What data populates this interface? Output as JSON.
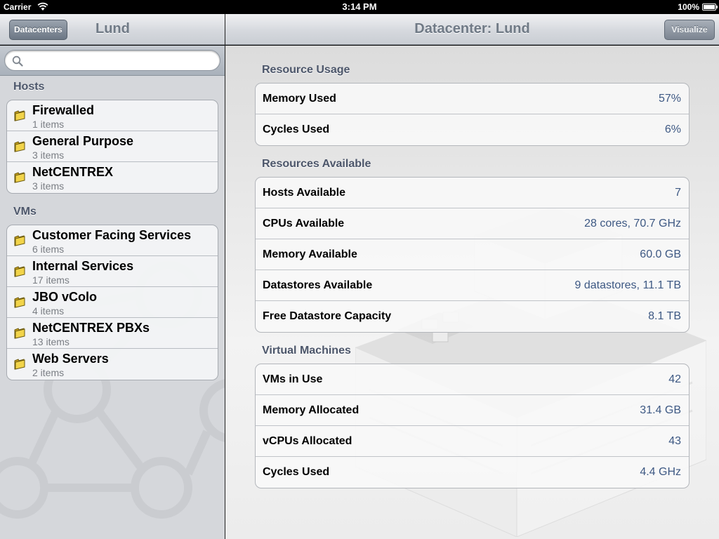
{
  "status": {
    "carrier": "Carrier",
    "time": "3:14 PM",
    "battery": "100%"
  },
  "master": {
    "back_label": "Datacenters",
    "title": "Lund",
    "search": {
      "placeholder": ""
    },
    "hosts_header": "Hosts",
    "hosts": [
      {
        "title": "Firewalled",
        "subtitle": "1 items"
      },
      {
        "title": "General Purpose",
        "subtitle": "3 items"
      },
      {
        "title": "NetCENTREX",
        "subtitle": "3 items"
      }
    ],
    "vms_header": "VMs",
    "vms": [
      {
        "title": "Customer Facing Services",
        "subtitle": "6 items"
      },
      {
        "title": "Internal Services",
        "subtitle": "17 items"
      },
      {
        "title": "JBO vColo",
        "subtitle": "4 items"
      },
      {
        "title": "NetCENTREX PBXs",
        "subtitle": "13 items"
      },
      {
        "title": "Web Servers",
        "subtitle": "2 items"
      }
    ]
  },
  "detail": {
    "title": "Datacenter: Lund",
    "visualize_label": "Visualize",
    "resource_usage": {
      "header": "Resource Usage",
      "rows": [
        {
          "label": "Memory Used",
          "value": "57%"
        },
        {
          "label": "Cycles Used",
          "value": "6%"
        }
      ]
    },
    "resources_available": {
      "header": "Resources Available",
      "rows": [
        {
          "label": "Hosts Available",
          "value": "7"
        },
        {
          "label": "CPUs Available",
          "value": "28 cores, 70.7 GHz"
        },
        {
          "label": "Memory Available",
          "value": "60.0 GB"
        },
        {
          "label": "Datastores Available",
          "value": "9 datastores, 11.1 TB"
        },
        {
          "label": "Free Datastore Capacity",
          "value": "8.1 TB"
        }
      ]
    },
    "virtual_machines": {
      "header": "Virtual Machines",
      "rows": [
        {
          "label": "VMs in Use",
          "value": "42"
        },
        {
          "label": "Memory Allocated",
          "value": "31.4 GB"
        },
        {
          "label": "vCPUs Allocated",
          "value": "43"
        },
        {
          "label": "Cycles Used",
          "value": "4.4 GHz"
        }
      ]
    }
  },
  "colors": {
    "value_text": "#3d5883",
    "section_header": "#4c566a"
  },
  "icons": {
    "folder": "folder-icon",
    "search": "search-icon",
    "wifi": "wifi-icon",
    "battery": "battery-icon",
    "back": "back-chevron"
  }
}
